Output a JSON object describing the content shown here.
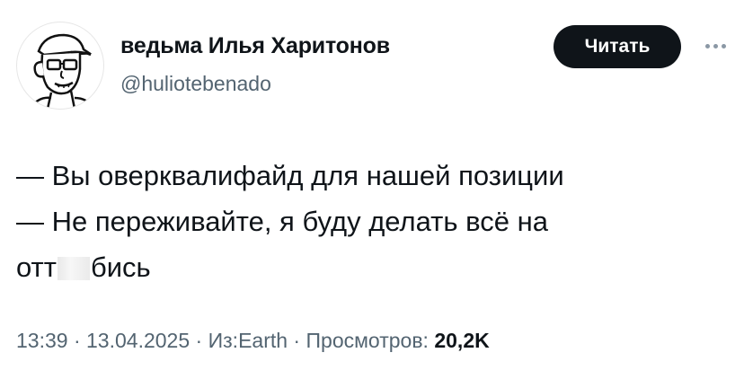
{
  "author": {
    "display_name": "ведьма Илья Харитонов",
    "handle": "@huliotebenado",
    "avatar_icon": "cartoon-man-with-glasses-and-cap-icon"
  },
  "actions": {
    "follow_label": "Читать",
    "more_icon": "more-horizontal-icon"
  },
  "tweet": {
    "line1": "— Вы оверквалифайд для нашей позиции",
    "line2": "— Не переживайте, я буду делать всё на",
    "line3_start": "отт",
    "line3_end": "бись"
  },
  "meta": {
    "time": "13:39",
    "date": "13.04.2025",
    "source_prefix": "Из:",
    "source": "Earth",
    "views_label": "Просмотров:",
    "views_count": "20,2K",
    "separator": " · "
  },
  "colors": {
    "text": "#0f1419",
    "secondary": "#536471",
    "button_bg": "#0f1419",
    "button_text": "#ffffff"
  }
}
